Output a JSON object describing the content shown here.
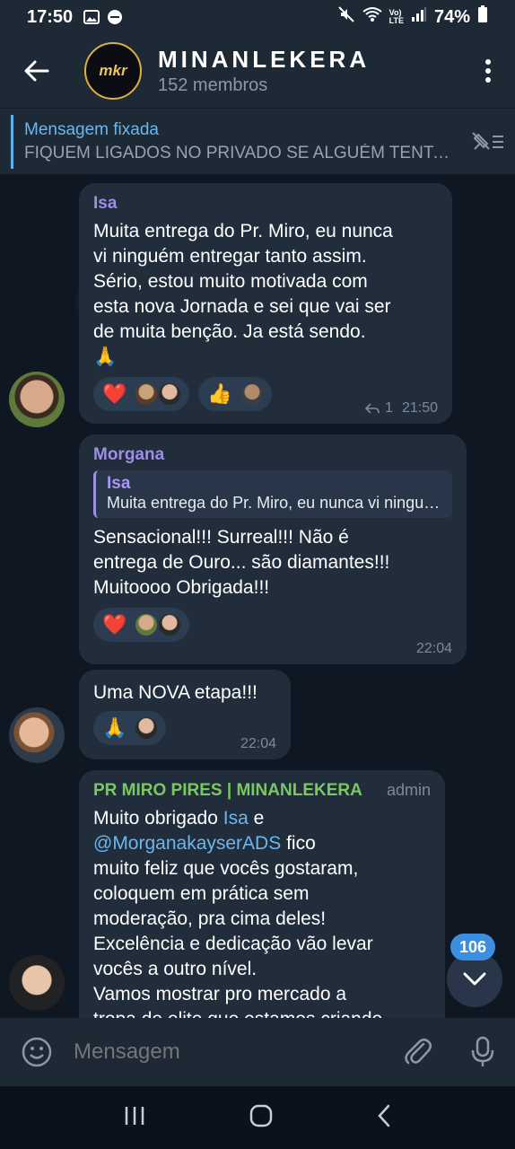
{
  "status": {
    "time": "17:50",
    "battery": "74%",
    "icons": [
      "image-icon",
      "dnd-icon",
      "mute-icon",
      "wifi-icon",
      "volte-icon",
      "signal-icon",
      "battery-icon"
    ]
  },
  "header": {
    "logo_text": "mkr",
    "title": "MINANLEKERA",
    "subtitle": "152 membros"
  },
  "pinned": {
    "label": "Mensagem fixada",
    "text": "FIQUEM LIGADOS NO PRIVADO SE ALGUÉM TENTAR..."
  },
  "messages": [
    {
      "sender": "Isa",
      "sender_color": "#9d8ee6",
      "lines": [
        "Muita entrega do Pr. Miro, eu nunca",
        "vi ninguém entregar tanto assim.",
        "Sério, estou muito motivada com",
        "esta nova Jornada e sei que vai ser",
        "de muita benção. Ja está sendo.",
        "🙏"
      ],
      "reactions": [
        {
          "emoji": "❤️",
          "avatars": 2
        },
        {
          "emoji": "👍",
          "avatars": 1
        }
      ],
      "replies": "1",
      "time": "21:50"
    },
    {
      "sender": "Morgana",
      "sender_color": "#9d8ee6",
      "quote_name": "Isa",
      "quote_text": "Muita entrega do Pr. Miro, eu nunca vi ninguém entregar tanto",
      "lines": [
        "Sensacional!!! Surreal!!! Não é",
        "entrega de Ouro... são diamantes!!!",
        "Muitoooo Obrigada!!!"
      ],
      "reactions": [
        {
          "emoji": "❤️",
          "avatars": 2
        }
      ],
      "time": "22:04"
    },
    {
      "lines": [
        "Uma NOVA etapa!!!"
      ],
      "reactions": [
        {
          "emoji": "🙏",
          "avatars": 1
        }
      ],
      "time": "22:04"
    },
    {
      "sender": "PR MIRO PIRES | MINANLEKERA",
      "sender_color": "#7bc862",
      "admin": "admin",
      "line1_a": "Muito obrigado ",
      "line1_link": "Isa",
      "line1_b": " e",
      "line2_link": "@MorganakayserADS",
      "line2_b": " fico",
      "lines": [
        "muito feliz que vocês gostaram,",
        "coloquem em prática sem",
        "moderação, pra cima deles!",
        "Excelência e dedicação vão levar",
        "vocês a outro nível.",
        "Vamos mostrar pro mercado a",
        "tropa de elite que estamos criando"
      ]
    }
  ],
  "unread_count": "106",
  "input": {
    "placeholder": "Mensagem"
  },
  "colors": {
    "background": "#0f1723",
    "bar": "#1e2936",
    "bubble": "#212d3b",
    "accent": "#5eb1f0"
  }
}
